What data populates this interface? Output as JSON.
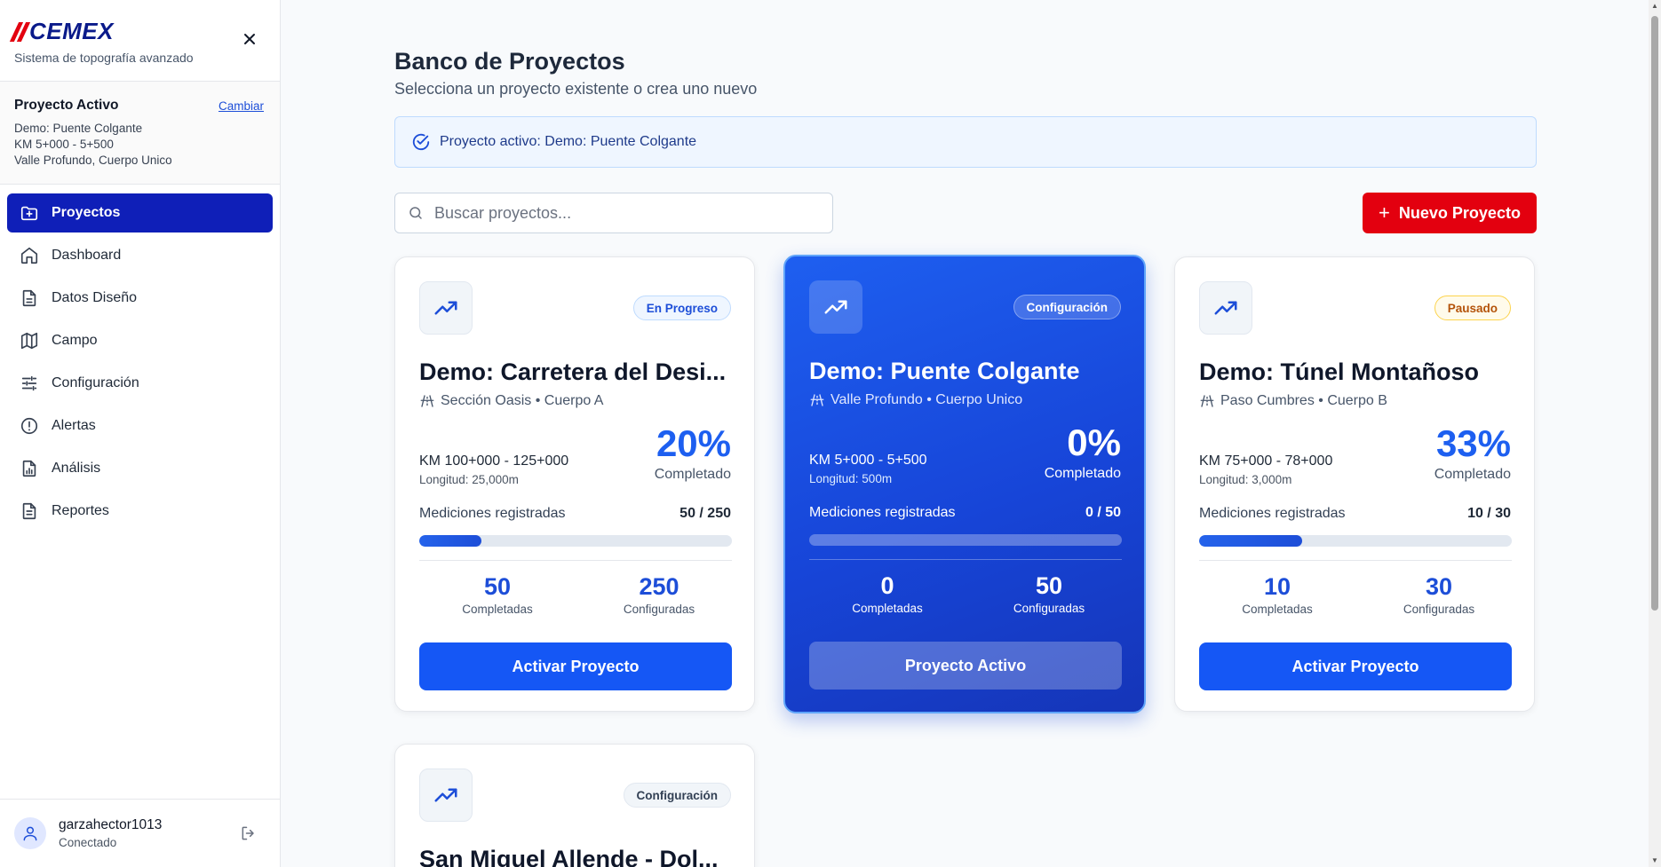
{
  "brand": {
    "name": "CEMEX",
    "subtitle": "Sistema de topografía avanzado"
  },
  "active_project": {
    "title": "Proyecto Activo",
    "change_label": "Cambiar",
    "name": "Demo: Puente Colgante",
    "km_range": "KM 5+000 - 5+500",
    "location": "Valle Profundo, Cuerpo Unico"
  },
  "nav": {
    "items": [
      {
        "label": "Proyectos",
        "icon": "folder-plus-icon",
        "active": true
      },
      {
        "label": "Dashboard",
        "icon": "home-icon"
      },
      {
        "label": "Datos Diseño",
        "icon": "document-icon"
      },
      {
        "label": "Campo",
        "icon": "map-icon"
      },
      {
        "label": "Configuración",
        "icon": "sliders-icon"
      },
      {
        "label": "Alertas",
        "icon": "alert-circle-icon"
      },
      {
        "label": "Análisis",
        "icon": "chart-file-icon"
      },
      {
        "label": "Reportes",
        "icon": "report-icon"
      }
    ]
  },
  "user": {
    "name": "garzahector1013",
    "status": "Conectado"
  },
  "page": {
    "title": "Banco de Proyectos",
    "subtitle": "Selecciona un proyecto existente o crea uno nuevo",
    "alert": "Proyecto activo: Demo: Puente Colgante",
    "search_placeholder": "Buscar proyectos...",
    "new_button": "Nuevo Proyecto"
  },
  "colors": {
    "primary": "#1557f5",
    "brand_red": "#e3000f",
    "brand_navy": "#0a1a8a",
    "active_nav": "#0f1fb8"
  },
  "projects": [
    {
      "status": "En Progreso",
      "title": "Demo: Carretera del Desi...",
      "location": "Sección Oasis • Cuerpo A",
      "km": "KM 100+000 - 125+000",
      "length": "Longitud: 25,000m",
      "percent": "20%",
      "percent_label": "Completado",
      "measurements_label": "Mediciones registradas",
      "measurements": "50 / 250",
      "progress": 0.2,
      "completed": "50",
      "completed_label": "Completadas",
      "configured": "250",
      "configured_label": "Configuradas",
      "button": "Activar Proyecto"
    },
    {
      "status": "Configuración",
      "title": "Demo: Puente Colgante",
      "location": "Valle Profundo • Cuerpo Unico",
      "km": "KM 5+000 - 5+500",
      "length": "Longitud: 500m",
      "percent": "0%",
      "percent_label": "Completado",
      "measurements_label": "Mediciones registradas",
      "measurements": "0 / 50",
      "progress": 0,
      "completed": "0",
      "completed_label": "Completadas",
      "configured": "50",
      "configured_label": "Configuradas",
      "button": "Proyecto Activo"
    },
    {
      "status": "Pausado",
      "title": "Demo: Túnel Montañoso",
      "location": "Paso Cumbres • Cuerpo B",
      "km": "KM 75+000 - 78+000",
      "length": "Longitud: 3,000m",
      "percent": "33%",
      "percent_label": "Completado",
      "measurements_label": "Mediciones registradas",
      "measurements": "10 / 30",
      "progress": 0.33,
      "completed": "10",
      "completed_label": "Completadas",
      "configured": "30",
      "configured_label": "Configuradas",
      "button": "Activar Proyecto"
    },
    {
      "status": "Configuración",
      "title": "San Miguel Allende - Dol..."
    }
  ]
}
